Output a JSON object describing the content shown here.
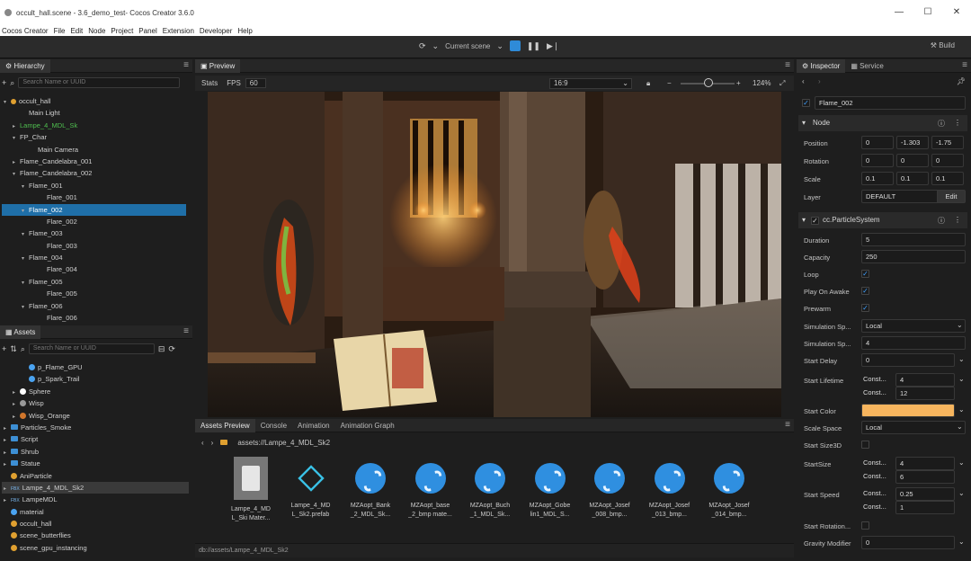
{
  "window": {
    "title": "occult_hall.scene - 3.6_demo_test- Cocos Creator 3.6.0",
    "min": "—",
    "max": "☐",
    "close": "✕"
  },
  "menu": [
    "Cocos Creator",
    "File",
    "Edit",
    "Node",
    "Project",
    "Panel",
    "Extension",
    "Developer",
    "Help"
  ],
  "toolbar": {
    "scene_select": "Current scene",
    "build": "Build"
  },
  "hierarchy": {
    "tab": "Hierarchy",
    "search_placeholder": "Search Name or UUID",
    "rows": [
      {
        "label": "occult_hall",
        "indent": 0,
        "arrow": "▾",
        "icon": true
      },
      {
        "label": "Main Light",
        "indent": 2,
        "arrow": ""
      },
      {
        "label": "Lampe_4_MDL_Sk",
        "indent": 1,
        "arrow": "▸",
        "green": true
      },
      {
        "label": "FP_Char",
        "indent": 1,
        "arrow": "▾"
      },
      {
        "label": "Main Camera",
        "indent": 3,
        "arrow": ""
      },
      {
        "label": "Flame_Candelabra_001",
        "indent": 1,
        "arrow": "▸"
      },
      {
        "label": "Flame_Candelabra_002",
        "indent": 1,
        "arrow": "▾"
      },
      {
        "label": "Flame_001",
        "indent": 2,
        "arrow": "▾"
      },
      {
        "label": "Flare_001",
        "indent": 4,
        "arrow": ""
      },
      {
        "label": "Flame_002",
        "indent": 2,
        "arrow": "▾",
        "selected": true
      },
      {
        "label": "Flare_002",
        "indent": 4,
        "arrow": ""
      },
      {
        "label": "Flame_003",
        "indent": 2,
        "arrow": "▾"
      },
      {
        "label": "Flare_003",
        "indent": 4,
        "arrow": ""
      },
      {
        "label": "Flame_004",
        "indent": 2,
        "arrow": "▾"
      },
      {
        "label": "Flare_004",
        "indent": 4,
        "arrow": ""
      },
      {
        "label": "Flame_005",
        "indent": 2,
        "arrow": "▾"
      },
      {
        "label": "Flare_005",
        "indent": 4,
        "arrow": ""
      },
      {
        "label": "Flame_006",
        "indent": 2,
        "arrow": "▾"
      },
      {
        "label": "Flare_006",
        "indent": 4,
        "arrow": ""
      }
    ]
  },
  "assets": {
    "tab": "Assets",
    "search_placeholder": "Search Name or UUID",
    "rows": [
      {
        "label": "p_Flame_GPU",
        "indent": 2,
        "kind": "dot",
        "color": "#4aa3f0"
      },
      {
        "label": "p_Spark_Trail",
        "indent": 2,
        "kind": "dot",
        "color": "#4aa3f0"
      },
      {
        "label": "Sphere",
        "indent": 1,
        "kind": "dot",
        "color": "#ffffff",
        "arrow": "▸"
      },
      {
        "label": "Wisp",
        "indent": 1,
        "kind": "dot",
        "color": "#999999",
        "arrow": "▸"
      },
      {
        "label": "Wisp_Orange",
        "indent": 1,
        "kind": "dot",
        "color": "#d0762b",
        "arrow": "▸"
      },
      {
        "label": "Particles_Smoke",
        "indent": 0,
        "kind": "folder",
        "arrow": "▸"
      },
      {
        "label": "Script",
        "indent": 0,
        "kind": "folder",
        "arrow": "▸"
      },
      {
        "label": "Shrub",
        "indent": 0,
        "kind": "folder",
        "arrow": "▸"
      },
      {
        "label": "Statue",
        "indent": 0,
        "kind": "folder",
        "arrow": "▸"
      },
      {
        "label": "AniParticle",
        "indent": 0,
        "kind": "dot",
        "color": "#e0a030"
      },
      {
        "label": "Lampe_4_MDL_Sk2",
        "indent": 0,
        "kind": "fbx",
        "arrow": "▸",
        "selected": true
      },
      {
        "label": "LampeMDL",
        "indent": 0,
        "kind": "fbx",
        "arrow": "▸"
      },
      {
        "label": "material",
        "indent": 0,
        "kind": "dot",
        "color": "#4aa3f0"
      },
      {
        "label": "occult_hall",
        "indent": 0,
        "kind": "dot",
        "color": "#e0a030"
      },
      {
        "label": "scene_butterflies",
        "indent": 0,
        "kind": "dot",
        "color": "#e0a030"
      },
      {
        "label": "scene_gpu_instancing",
        "indent": 0,
        "kind": "dot",
        "color": "#e0a030"
      }
    ]
  },
  "preview": {
    "tab": "Preview",
    "stats": "Stats",
    "fps_label": "FPS",
    "fps_value": "60",
    "ratio": "16:9",
    "zoom": "124%"
  },
  "bottom": {
    "tabs": [
      "Assets Preview",
      "Console",
      "Animation",
      "Animation Graph"
    ],
    "path": "assets://Lampe_4_MDL_Sk2",
    "footer_path": "db://assets/Lampe_4_MDL_Sk2",
    "cards": [
      {
        "name": "Lampe_4_MD L_Ski Mater...",
        "kind": "material"
      },
      {
        "name": "Lampe_4_MD L_Sk2.prefab",
        "kind": "prefab"
      },
      {
        "name": "MZAopt_Bank _2_MDL_Sk...",
        "kind": "ribbon"
      },
      {
        "name": "MZAopt_base _2_bmp mate...",
        "kind": "ribbon"
      },
      {
        "name": "MZAopt_Buch _1_MDL_Sk...",
        "kind": "ribbon"
      },
      {
        "name": "MZAopt_Gobe lin1_MDL_S...",
        "kind": "ribbon"
      },
      {
        "name": "MZAopt_Josef _008_bmp...",
        "kind": "ribbon"
      },
      {
        "name": "MZAopt_Josef _013_bmp...",
        "kind": "ribbon"
      },
      {
        "name": "MZAopt_Josef _014_bmp...",
        "kind": "ribbon"
      }
    ]
  },
  "inspector": {
    "tabs": [
      "Inspector",
      "Service"
    ],
    "node_name": "Flame_002",
    "node_section": "Node",
    "position": [
      "0",
      "-1.303",
      "-1.75"
    ],
    "rotation": [
      "0",
      "0",
      "0"
    ],
    "scale": [
      "0.1",
      "0.1",
      "0.1"
    ],
    "labels": {
      "position": "Position",
      "rotation": "Rotation",
      "scale": "Scale",
      "layer": "Layer",
      "duration": "Duration",
      "capacity": "Capacity",
      "loop": "Loop",
      "play_on_awake": "Play On Awake",
      "prewarm": "Prewarm",
      "sim_space": "Simulation Sp...",
      "sim_speed": "Simulation Sp...",
      "start_delay": "Start Delay",
      "start_lifetime": "Start Lifetime",
      "start_color": "Start Color",
      "scale_space": "Scale Space",
      "start_size_3d": "Start Size3D",
      "start_size": "StartSize",
      "start_speed": "Start Speed",
      "start_rotation": "Start Rotation...",
      "gravity": "Gravity Modifier"
    },
    "layer": "DEFAULT",
    "edit": "Edit",
    "component": "cc.ParticleSystem",
    "duration": "5",
    "capacity": "250",
    "sim_space": "Local",
    "sim_speed": "4",
    "start_delay": "0",
    "lifetime_mode": "Const...",
    "lifetime_a": "4",
    "lifetime_b": "12",
    "start_color": "#f7b55e",
    "scale_space": "Local",
    "size_mode": "Const...",
    "size_a": "4",
    "size_b": "6",
    "speed_mode": "Const...",
    "speed_a": "0.25",
    "speed_b": "1",
    "gravity": "0"
  }
}
